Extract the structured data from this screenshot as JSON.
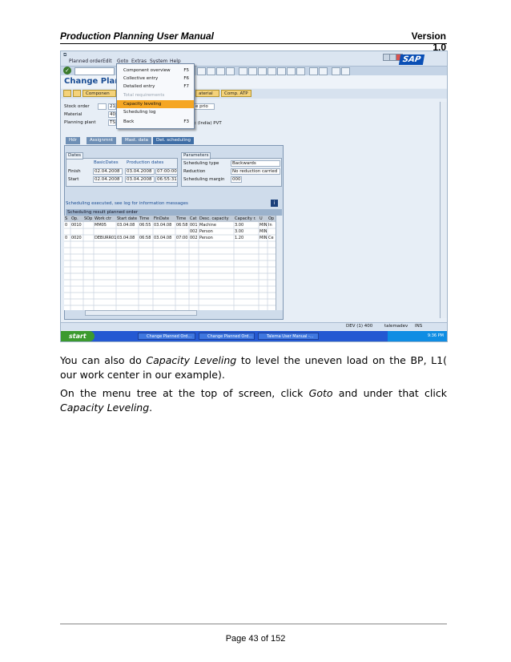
{
  "doc": {
    "title": "Production Planning User Manual",
    "version": "Version 1.0",
    "page": "Page 43 of 152"
  },
  "paragraphs": {
    "p1_a": "You can also do ",
    "p1_em": "Capacity Leveling",
    "p1_b": " to level the uneven load on the BP, L1( our work center in our example).",
    "p2_a": "On the menu tree at the top of screen, click ",
    "p2_em1": "Goto",
    "p2_b": " and under that click ",
    "p2_em2": "Capacity Leveling",
    "p2_c": "."
  },
  "sap": {
    "menu": [
      "Planned order",
      "Edit",
      "Goto",
      "Extras",
      "System",
      "Help"
    ],
    "logo": "SAP",
    "app_title": "Change Planne",
    "toolbar2": {
      "component": "Componen",
      "material": "aterial",
      "comp_atp": "Comp. ATP"
    },
    "fields": {
      "stock_order_label": "Stock order",
      "stock_order_value": "21",
      "material_label": "Material",
      "material_value": "400",
      "plant_label": "Planning plant",
      "plant_value": "TSI",
      "prio_fragment": "e prio",
      "plant_text": "c (India) PVT"
    },
    "tabs": [
      "Hdr",
      "Assignmnt",
      "Mast. data",
      "Det. scheduling"
    ],
    "dates": {
      "title": "Dates",
      "col1": "BasicDates",
      "col2": "Production dates",
      "finish_label": "Finish",
      "finish_basic": "02.04.2008",
      "finish_prod_date": "03.04.2008",
      "finish_prod_time": "07:00:00",
      "start_label": "Start",
      "start_basic": "02.04.2008",
      "start_prod_date": "03.04.2008",
      "start_prod_time": "06:55:31"
    },
    "parameters": {
      "title": "Parameters",
      "type_label": "Scheduling type",
      "type_value": "Backwards",
      "reduction_label": "Reduction",
      "reduction_value": "No reduction carried",
      "margin_label": "Scheduling margin",
      "margin_value": "000"
    },
    "message": "Scheduling executed, see log for information messages",
    "grid": {
      "title": "Scheduling result planned order",
      "headers": [
        "S",
        "Op.",
        "SOp",
        "Work ctr",
        "Start date",
        "Time",
        "FinDate",
        "Time",
        "Cat",
        "Desc. capacity",
        "Capacity r.",
        "U",
        "Op"
      ],
      "rows": [
        [
          "0",
          "0010",
          "",
          "MM05",
          "03.04.08",
          "06:55",
          "03.04.08",
          "06:58",
          "001",
          "Machine",
          "3.00",
          "MIN",
          "In"
        ],
        [
          "",
          "",
          "",
          "",
          "",
          "",
          "",
          "",
          "002",
          "Person",
          "3.00",
          "MIN",
          ""
        ],
        [
          "0",
          "0020",
          "",
          "DEBURR01",
          "03.04.08",
          "06:58",
          "03.04.08",
          "07:00",
          "002",
          "Person",
          "1.20",
          "MIN",
          "Ce"
        ]
      ]
    },
    "status": {
      "system": "DEV (1) 400",
      "user": "talemadev",
      "mode": "INS"
    },
    "taskbar": {
      "start": "start",
      "items": [
        "Change Planned Ord...",
        "Change Planned Ord...",
        "Talema User Manual -..."
      ],
      "clock": "9:36 PM"
    },
    "goto_menu": [
      {
        "label": "Component overview",
        "key": "F5"
      },
      {
        "label": "Collective entry",
        "key": "F6"
      },
      {
        "label": "Detailed entry",
        "key": "F7"
      },
      {
        "label": "Total requirements",
        "key": ""
      },
      {
        "label": "Capacity leveling",
        "key": ""
      },
      {
        "label": "Scheduling log",
        "key": ""
      },
      {
        "label": "Back",
        "key": "F3"
      }
    ]
  }
}
